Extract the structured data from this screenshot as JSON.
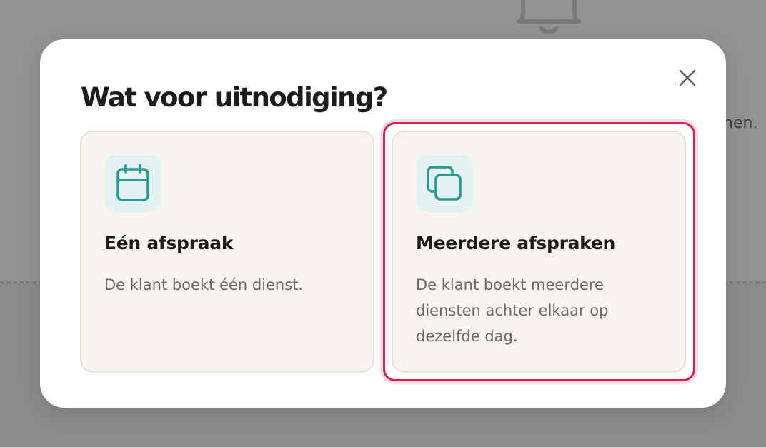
{
  "background": {
    "partial_text": "nen."
  },
  "modal": {
    "title": "Wat voor uitnodiging?",
    "close_icon": "close-icon",
    "options": [
      {
        "title": "Eén afspraak",
        "description": "De klant boekt één dienst.",
        "icon": "calendar-icon",
        "selected": false
      },
      {
        "title": "Meerdere afspraken",
        "description": "De klant boekt meerdere diensten achter elkaar op dezelfde dag.",
        "icon": "stacked-squares-icon",
        "selected": true
      }
    ]
  },
  "colors": {
    "accent_teal": "#2b9a8c",
    "icon_tile_bg": "#e4f3f1",
    "card_bg": "#f8f5f0",
    "selection_border": "#d8214f",
    "overlay": "#8e8d8b"
  }
}
